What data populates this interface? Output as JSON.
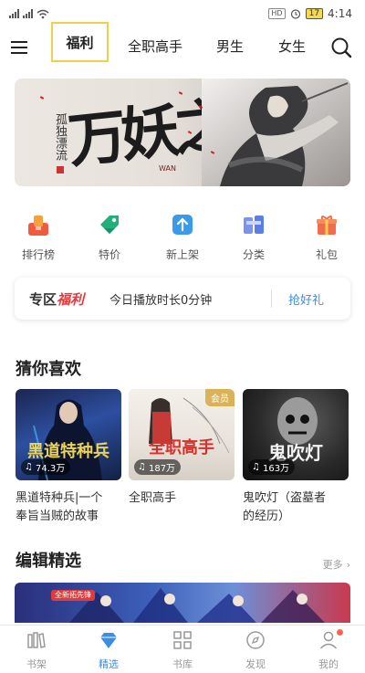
{
  "status_bar": {
    "hd": "HD",
    "battery": "17",
    "time": "4:14"
  },
  "nav": {
    "tabs": [
      "福利",
      "全职高手",
      "男生",
      "女生"
    ],
    "active_tab": "福利",
    "menu_icon": "menu-icon",
    "search_icon": "search-icon"
  },
  "banner": {
    "calligraphy": "万妖之祖",
    "author": "孤独漂流",
    "subtitle": "WAN"
  },
  "categories": [
    {
      "label": "排行榜",
      "icon": "ranking-icon",
      "color": "#f05a3e"
    },
    {
      "label": "特价",
      "icon": "price-tag-icon",
      "color": "#22b07a"
    },
    {
      "label": "新上架",
      "icon": "upload-icon",
      "color": "#3b9be8"
    },
    {
      "label": "分类",
      "icon": "category-icon",
      "color": "#5a7fe6"
    },
    {
      "label": "礼包",
      "icon": "gift-icon",
      "color": "#f26b4f"
    }
  ],
  "zone": {
    "title_prefix": "专区",
    "title_highlight": "福利",
    "text": "今日播放时长0分钟",
    "button": "抢好礼"
  },
  "guess": {
    "title": "猜你喜欢",
    "books": [
      {
        "cover_text": "黑道特种兵",
        "plays": "74.3万",
        "title_line1": "黑道特种兵|一个",
        "title_line2": "奉旨当贼的故事",
        "vip": ""
      },
      {
        "cover_text": "全职高手",
        "plays": "187万",
        "title_line1": "全职高手",
        "title_line2": "",
        "vip": "会员"
      },
      {
        "cover_text": "鬼吹灯",
        "plays": "163万",
        "title_line1": "鬼吹灯（盗墓者",
        "title_line2": "的经历）",
        "vip": ""
      }
    ]
  },
  "editor": {
    "title": "编辑精选",
    "more": "更多",
    "tag": "全新拓先锋"
  },
  "bottom_tabs": [
    {
      "label": "书架",
      "icon": "bookshelf-icon"
    },
    {
      "label": "精选",
      "icon": "diamond-icon"
    },
    {
      "label": "书库",
      "icon": "library-grid-icon"
    },
    {
      "label": "发现",
      "icon": "compass-icon"
    },
    {
      "label": "我的",
      "icon": "profile-icon"
    }
  ],
  "colors": {
    "accent": "#3a8ee6",
    "red": "#e8383d",
    "active_tab_border": "#f5cd4c",
    "vip_gold": "#d9b25a"
  }
}
